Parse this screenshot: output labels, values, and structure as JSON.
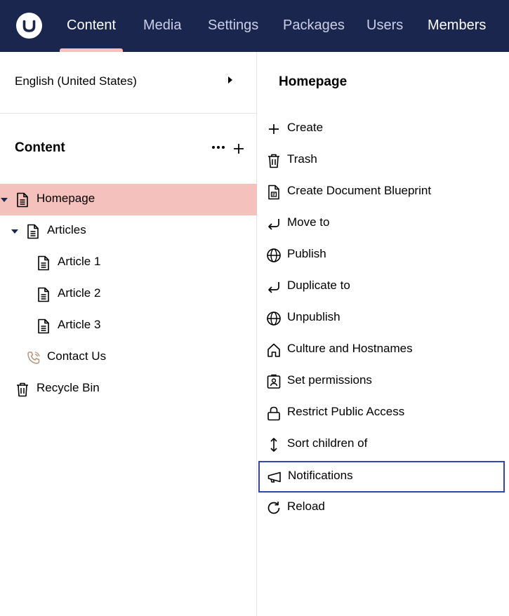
{
  "header": {
    "logo": "umbraco-logo-icon",
    "nav": [
      {
        "label": "Content",
        "active": true
      },
      {
        "label": "Media"
      },
      {
        "label": "Settings"
      },
      {
        "label": "Packages"
      },
      {
        "label": "Users"
      },
      {
        "label": "Members"
      }
    ],
    "colors": {
      "bar": "#1b264f",
      "underline": "#f5c1bc"
    }
  },
  "tree": {
    "language": "English (United States)",
    "section_title": "Content",
    "items": [
      {
        "label": "Homepage",
        "icon": "document-icon",
        "selected": true,
        "expanded": true
      },
      {
        "label": "Articles",
        "icon": "document-icon",
        "expanded": true
      },
      {
        "label": "Article 1",
        "icon": "document-icon"
      },
      {
        "label": "Article 2",
        "icon": "document-icon"
      },
      {
        "label": "Article 3",
        "icon": "document-icon"
      },
      {
        "label": "Contact Us",
        "icon": "phone-icon"
      },
      {
        "label": "Recycle Bin",
        "icon": "trash-icon"
      }
    ],
    "selected_color": "#f5c1bc"
  },
  "actions": {
    "title": "Homepage",
    "items": [
      {
        "label": "Create",
        "icon": "plus-icon"
      },
      {
        "label": "Trash",
        "icon": "trash-icon"
      },
      {
        "label": "Create Document Blueprint",
        "icon": "blueprint-icon"
      },
      {
        "label": "Move to",
        "icon": "enter-arrow-icon"
      },
      {
        "label": "Publish",
        "icon": "globe-icon"
      },
      {
        "label": "Duplicate to",
        "icon": "enter-arrow-icon"
      },
      {
        "label": "Unpublish",
        "icon": "globe-icon"
      },
      {
        "label": "Culture and Hostnames",
        "icon": "home-icon"
      },
      {
        "label": "Set permissions",
        "icon": "badge-icon"
      },
      {
        "label": "Restrict Public Access",
        "icon": "lock-icon"
      },
      {
        "label": "Sort children of",
        "icon": "vertical-arrows-icon"
      },
      {
        "label": "Notifications",
        "icon": "megaphone-icon",
        "focused": true
      },
      {
        "label": "Reload",
        "icon": "refresh-icon"
      }
    ],
    "focus_color": "#3544b1"
  }
}
